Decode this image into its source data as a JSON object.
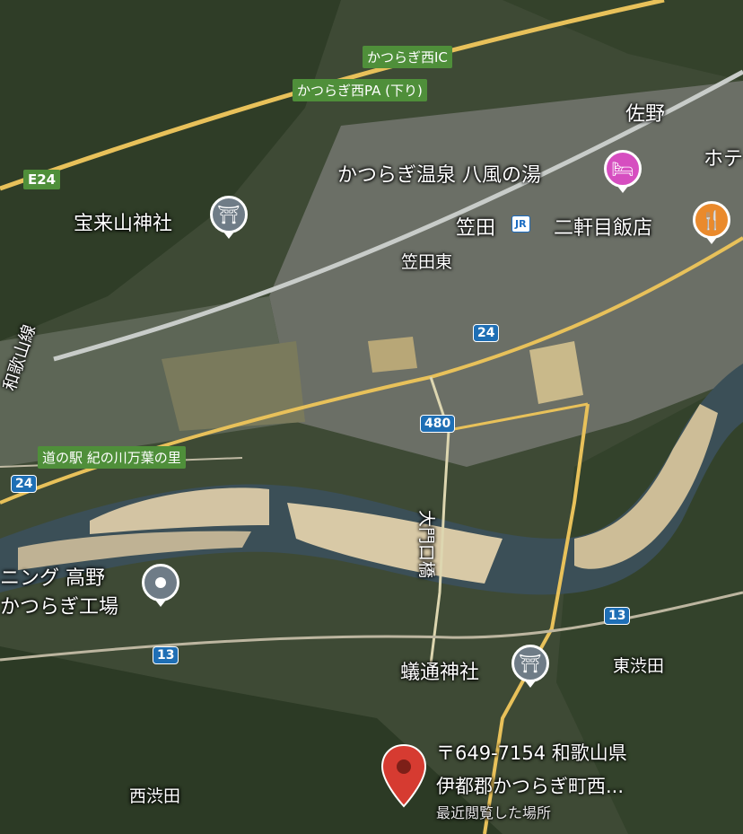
{
  "map": {
    "place_labels": {
      "sano": "佐野",
      "onsen": "かつらぎ温泉 八風の湯",
      "hotel_partial": "ホテ",
      "hourai_shrine": "宝来山神社",
      "kasada": "笠田",
      "nikenme": "二軒目飯店",
      "kasada_higashi": "笠田東",
      "wakayama_line": "和歌山線",
      "daimonguchi_bridge": "大門口橋",
      "factory_line1": "ニング 高野",
      "factory_line2": "かつらぎ工場",
      "ario_shrine": "蟻通神社",
      "higashi_shibuta": "東渋田",
      "nishi_shibuta": "西渋田"
    },
    "green_labels": {
      "ic": "かつらぎ西IC",
      "pa": "かつらぎ西PA (下り)",
      "roadside_station": "道の駅 紀の川万葉の里"
    },
    "route_shields": {
      "e24": "E24",
      "r24_a": "24",
      "r24_b": "24",
      "r480": "480",
      "r13_a": "13",
      "r13_b": "13"
    },
    "jr_badge": "JR",
    "icons": {
      "shrine": "torii-icon",
      "hotel": "bed-icon",
      "restaurant": "fork-knife-icon",
      "factory": "place-dot-icon",
      "pin": "location-pin-icon"
    },
    "selected_place": {
      "address_line1": "〒649-7154 和歌山県",
      "address_line2": "伊都郡かつらぎ町西...",
      "status": "最近閲覧した場所"
    },
    "colors": {
      "pin": "#d63b31",
      "shrine_pin": "#6f7c87",
      "hotel_pin": "#d64ec0",
      "restaurant_pin": "#ea8a2c",
      "green_label": "#4f8f3a",
      "route_shield": "#1f6fb5",
      "highway": "#e8c15a"
    }
  }
}
